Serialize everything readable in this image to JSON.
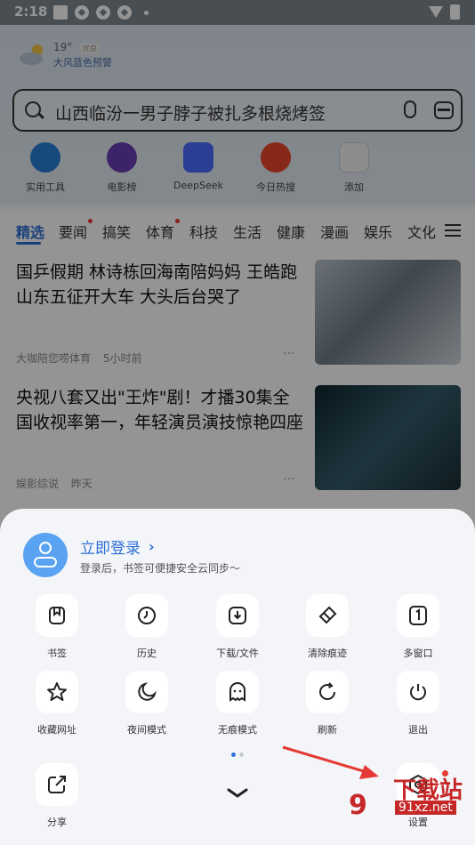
{
  "status_bar": {
    "time": "2:18"
  },
  "weather": {
    "temp": "19°",
    "tag": "优良",
    "alert": "大风蓝色预警"
  },
  "search": {
    "text": "山西临汾一男子脖子被扎多根烧烤签"
  },
  "shortcuts": [
    {
      "label": "实用工具",
      "color": "#2a7fd6"
    },
    {
      "label": "电影榜",
      "color": "#6a3fb3"
    },
    {
      "label": "DeepSeek",
      "color": "#4d6bfe"
    },
    {
      "label": "今日热搜",
      "color": "#e8452c"
    },
    {
      "label": "添加",
      "color": "#d8d8d8"
    }
  ],
  "tabs": [
    "精选",
    "要闻",
    "搞笑",
    "体育",
    "科技",
    "生活",
    "健康",
    "漫画",
    "娱乐",
    "文化"
  ],
  "news": [
    {
      "title": "国乒假期 林诗栋回海南陪妈妈 王皓跑山东五征开大车 大头后台哭了",
      "source": "大咖陪您唠体育",
      "time": "5小时前"
    },
    {
      "title": "央视八套又出\"王炸\"剧！才播30集全国收视率第一，年轻演员演技惊艳四座",
      "source": "娱影综说",
      "time": "昨天"
    }
  ],
  "login": {
    "title": "立即登录",
    "subtitle": "登录后，书签可便捷安全云同步～"
  },
  "menu": {
    "row1": [
      "书签",
      "历史",
      "下载/文件",
      "清除痕迹",
      "多窗口"
    ],
    "row2": [
      "收藏网址",
      "夜间模式",
      "无痕模式",
      "刷新",
      "退出"
    ],
    "row3": {
      "share": "分享",
      "settings": "设置"
    }
  },
  "watermark": {
    "brand": "下载站",
    "url": "91xz.net"
  },
  "colors": {
    "accent": "#2d6fd6",
    "arrow": "#e53935"
  }
}
